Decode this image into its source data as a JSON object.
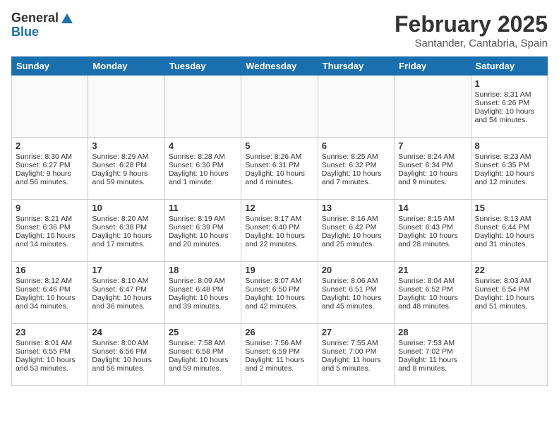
{
  "header": {
    "logo_general": "General",
    "logo_blue": "Blue",
    "title": "February 2025",
    "subtitle": "Santander, Cantabria, Spain"
  },
  "days_of_week": [
    "Sunday",
    "Monday",
    "Tuesday",
    "Wednesday",
    "Thursday",
    "Friday",
    "Saturday"
  ],
  "weeks": [
    [
      {
        "day": "",
        "empty": true
      },
      {
        "day": "",
        "empty": true
      },
      {
        "day": "",
        "empty": true
      },
      {
        "day": "",
        "empty": true
      },
      {
        "day": "",
        "empty": true
      },
      {
        "day": "",
        "empty": true
      },
      {
        "day": "1",
        "sunrise": "Sunrise: 8:31 AM",
        "sunset": "Sunset: 6:26 PM",
        "daylight": "Daylight: 10 hours and 54 minutes."
      }
    ],
    [
      {
        "day": "2",
        "sunrise": "Sunrise: 8:30 AM",
        "sunset": "Sunset: 6:27 PM",
        "daylight": "Daylight: 9 hours and 56 minutes."
      },
      {
        "day": "3",
        "sunrise": "Sunrise: 8:29 AM",
        "sunset": "Sunset: 6:28 PM",
        "daylight": "Daylight: 9 hours and 59 minutes."
      },
      {
        "day": "4",
        "sunrise": "Sunrise: 8:28 AM",
        "sunset": "Sunset: 6:30 PM",
        "daylight": "Daylight: 10 hours and 1 minute."
      },
      {
        "day": "5",
        "sunrise": "Sunrise: 8:26 AM",
        "sunset": "Sunset: 6:31 PM",
        "daylight": "Daylight: 10 hours and 4 minutes."
      },
      {
        "day": "6",
        "sunrise": "Sunrise: 8:25 AM",
        "sunset": "Sunset: 6:32 PM",
        "daylight": "Daylight: 10 hours and 7 minutes."
      },
      {
        "day": "7",
        "sunrise": "Sunrise: 8:24 AM",
        "sunset": "Sunset: 6:34 PM",
        "daylight": "Daylight: 10 hours and 9 minutes."
      },
      {
        "day": "8",
        "sunrise": "Sunrise: 8:23 AM",
        "sunset": "Sunset: 6:35 PM",
        "daylight": "Daylight: 10 hours and 12 minutes."
      }
    ],
    [
      {
        "day": "9",
        "sunrise": "Sunrise: 8:21 AM",
        "sunset": "Sunset: 6:36 PM",
        "daylight": "Daylight: 10 hours and 14 minutes."
      },
      {
        "day": "10",
        "sunrise": "Sunrise: 8:20 AM",
        "sunset": "Sunset: 6:38 PM",
        "daylight": "Daylight: 10 hours and 17 minutes."
      },
      {
        "day": "11",
        "sunrise": "Sunrise: 8:19 AM",
        "sunset": "Sunset: 6:39 PM",
        "daylight": "Daylight: 10 hours and 20 minutes."
      },
      {
        "day": "12",
        "sunrise": "Sunrise: 8:17 AM",
        "sunset": "Sunset: 6:40 PM",
        "daylight": "Daylight: 10 hours and 22 minutes."
      },
      {
        "day": "13",
        "sunrise": "Sunrise: 8:16 AM",
        "sunset": "Sunset: 6:42 PM",
        "daylight": "Daylight: 10 hours and 25 minutes."
      },
      {
        "day": "14",
        "sunrise": "Sunrise: 8:15 AM",
        "sunset": "Sunset: 6:43 PM",
        "daylight": "Daylight: 10 hours and 28 minutes."
      },
      {
        "day": "15",
        "sunrise": "Sunrise: 8:13 AM",
        "sunset": "Sunset: 6:44 PM",
        "daylight": "Daylight: 10 hours and 31 minutes."
      }
    ],
    [
      {
        "day": "16",
        "sunrise": "Sunrise: 8:12 AM",
        "sunset": "Sunset: 6:46 PM",
        "daylight": "Daylight: 10 hours and 34 minutes."
      },
      {
        "day": "17",
        "sunrise": "Sunrise: 8:10 AM",
        "sunset": "Sunset: 6:47 PM",
        "daylight": "Daylight: 10 hours and 36 minutes."
      },
      {
        "day": "18",
        "sunrise": "Sunrise: 8:09 AM",
        "sunset": "Sunset: 6:48 PM",
        "daylight": "Daylight: 10 hours and 39 minutes."
      },
      {
        "day": "19",
        "sunrise": "Sunrise: 8:07 AM",
        "sunset": "Sunset: 6:50 PM",
        "daylight": "Daylight: 10 hours and 42 minutes."
      },
      {
        "day": "20",
        "sunrise": "Sunrise: 8:06 AM",
        "sunset": "Sunset: 6:51 PM",
        "daylight": "Daylight: 10 hours and 45 minutes."
      },
      {
        "day": "21",
        "sunrise": "Sunrise: 8:04 AM",
        "sunset": "Sunset: 6:52 PM",
        "daylight": "Daylight: 10 hours and 48 minutes."
      },
      {
        "day": "22",
        "sunrise": "Sunrise: 8:03 AM",
        "sunset": "Sunset: 6:54 PM",
        "daylight": "Daylight: 10 hours and 51 minutes."
      }
    ],
    [
      {
        "day": "23",
        "sunrise": "Sunrise: 8:01 AM",
        "sunset": "Sunset: 6:55 PM",
        "daylight": "Daylight: 10 hours and 53 minutes."
      },
      {
        "day": "24",
        "sunrise": "Sunrise: 8:00 AM",
        "sunset": "Sunset: 6:56 PM",
        "daylight": "Daylight: 10 hours and 56 minutes."
      },
      {
        "day": "25",
        "sunrise": "Sunrise: 7:58 AM",
        "sunset": "Sunset: 6:58 PM",
        "daylight": "Daylight: 10 hours and 59 minutes."
      },
      {
        "day": "26",
        "sunrise": "Sunrise: 7:56 AM",
        "sunset": "Sunset: 6:59 PM",
        "daylight": "Daylight: 11 hours and 2 minutes."
      },
      {
        "day": "27",
        "sunrise": "Sunrise: 7:55 AM",
        "sunset": "Sunset: 7:00 PM",
        "daylight": "Daylight: 11 hours and 5 minutes."
      },
      {
        "day": "28",
        "sunrise": "Sunrise: 7:53 AM",
        "sunset": "Sunset: 7:02 PM",
        "daylight": "Daylight: 11 hours and 8 minutes."
      },
      {
        "day": "",
        "empty": true
      }
    ]
  ]
}
